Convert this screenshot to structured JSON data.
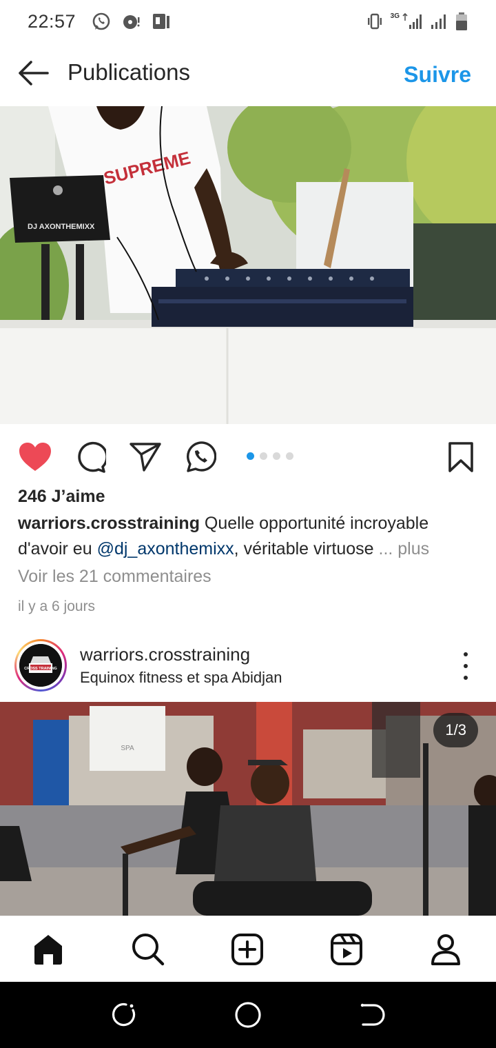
{
  "status_bar": {
    "time": "22:57",
    "network": "3G"
  },
  "header": {
    "title": "Publications",
    "follow_label": "Suivre"
  },
  "post1": {
    "likes": "246 J’aime",
    "caption_user": "warriors.crosstraining",
    "caption_text_1": " Quelle opportunité incroyable d'avoir eu ",
    "caption_mention": "@dj_axonthemixx",
    "caption_text_2": ", véritable virtuose ",
    "caption_more": "... plus",
    "comments_link": "Voir les 21 commentaires",
    "timestamp": "il y a 6 jours",
    "carousel_total": 4,
    "carousel_index": 1,
    "image_laptop_text": "DJ AXONTHEMIXX",
    "image_shirt_text": "SUPREME"
  },
  "post2": {
    "username": "warriors.crosstraining",
    "location": "Equinox fitness et spa Abidjan",
    "counter": "1/3",
    "avatar_text": "CROSS TRAINING",
    "image_banner_text": "SPA"
  },
  "colors": {
    "accent": "#1c96e8",
    "like_red": "#ed4956",
    "mention": "#00376b",
    "muted": "#8e8e8e"
  },
  "icons": {
    "back": "arrow-left-icon",
    "like": "heart-filled-icon",
    "comment": "comment-bubble-icon",
    "share": "paper-plane-icon",
    "whatsapp": "whatsapp-icon",
    "save": "bookmark-icon",
    "nav_home": "home-icon",
    "nav_search": "search-icon",
    "nav_create": "plus-square-icon",
    "nav_reels": "reels-icon",
    "nav_profile": "profile-icon"
  }
}
